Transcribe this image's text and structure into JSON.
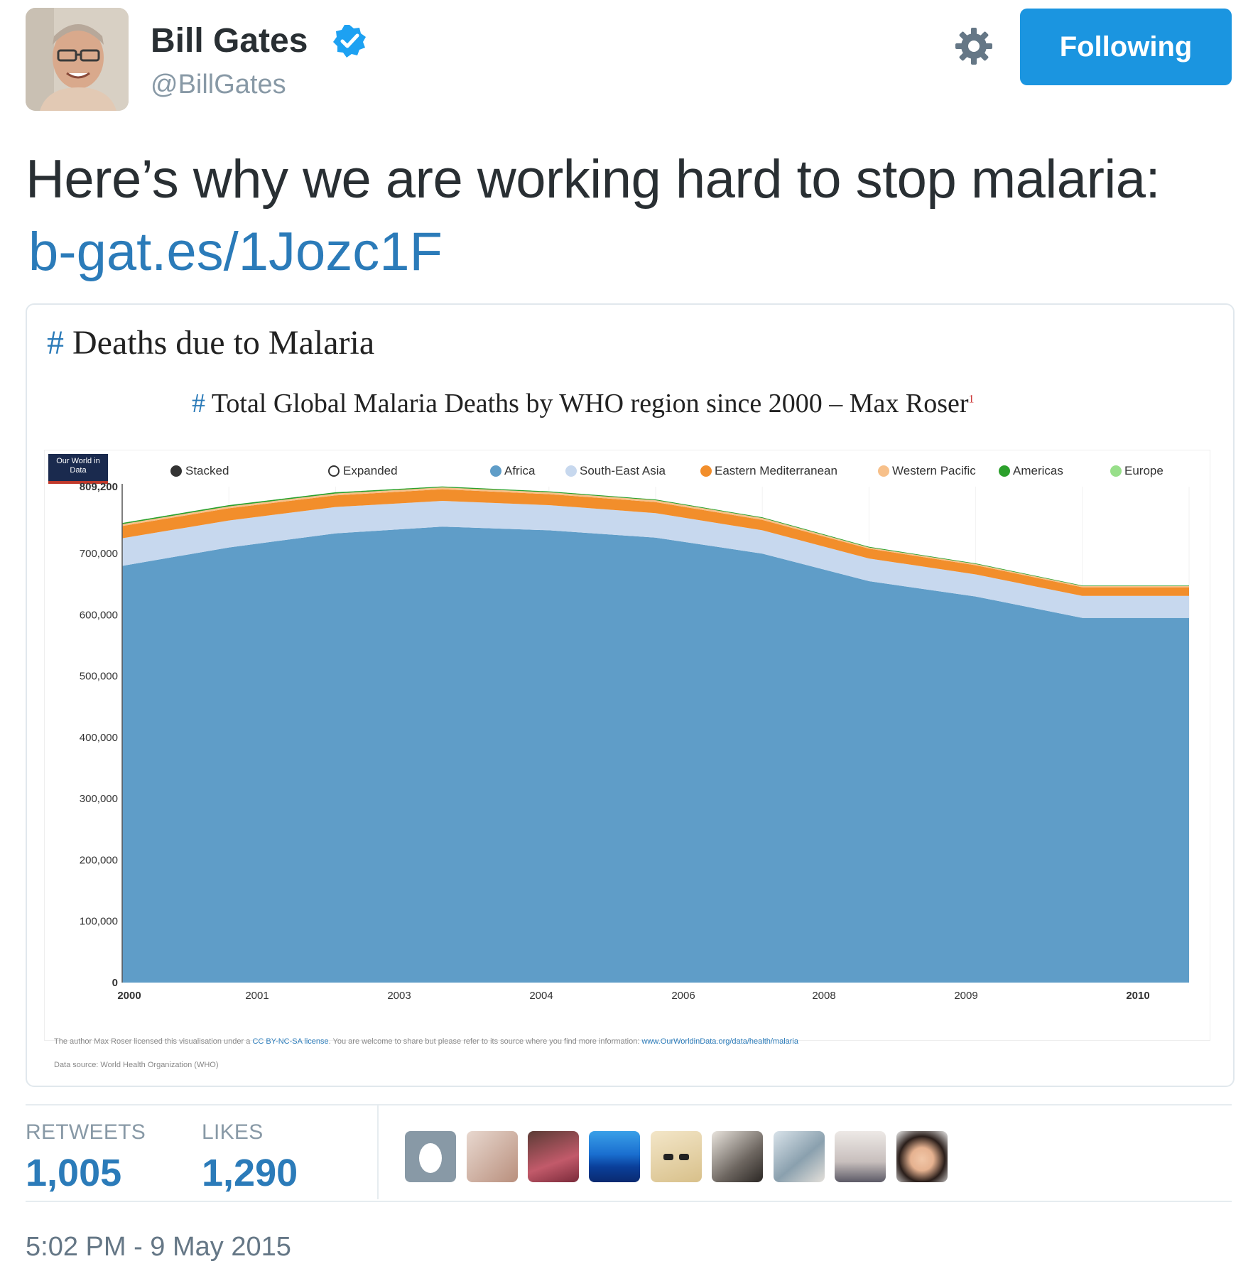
{
  "user": {
    "name": "Bill Gates",
    "handle": "@BillGates",
    "follow_label": "Following"
  },
  "tweet": {
    "text": "Here’s why we are working hard to stop malaria:",
    "link": "b-gat.es/1Jozc1F"
  },
  "card": {
    "hash": "#",
    "title": "Deaths due to Malaria",
    "chart_title": "Total Global Malaria Deaths by WHO region since 2000 – Max Roser",
    "chart_title_sup": "1",
    "logo_text": "Our World in Data",
    "controls": [
      "Stacked",
      "Expanded"
    ],
    "footnote_prefix": "The author Max Roser licensed this visualisation under a",
    "footnote_license": "CC BY-NC-SA license",
    "footnote_middle": ". You are welcome to share but please refer to its source where you find more information:",
    "footnote_url": "www.OurWorldinData.org/data/health/malaria",
    "data_source": "Data source: World Health Organization (WHO)"
  },
  "chart_data": {
    "type": "area",
    "title": "Total Global Malaria Deaths by WHO region since 2000 – Max Roser",
    "stacked": true,
    "x": [
      2000,
      2001,
      2002,
      2003,
      2004,
      2005,
      2006,
      2007,
      2008,
      2009,
      2010
    ],
    "x_tick_labels": [
      "2000",
      "2001",
      "2003",
      "2004",
      "2006",
      "2008",
      "2009",
      "2010"
    ],
    "y_tick_labels": [
      "0",
      "100,000",
      "200,000",
      "300,000",
      "400,000",
      "500,000",
      "600,000",
      "700,000",
      "809,200"
    ],
    "ylim": [
      0,
      809200
    ],
    "legend_position": "top",
    "series": [
      {
        "name": "Africa",
        "color": "#5f9dc8",
        "values": [
          680000,
          710000,
          733000,
          744000,
          738000,
          726000,
          700000,
          655000,
          630000,
          595000,
          595000
        ]
      },
      {
        "name": "South-East Asia",
        "color": "#c7d8ee",
        "values": [
          45000,
          44000,
          43000,
          42000,
          41000,
          40000,
          38000,
          37000,
          36000,
          36000,
          36000
        ]
      },
      {
        "name": "Eastern Mediterranean",
        "color": "#f28e2b",
        "values": [
          20000,
          20000,
          19000,
          19000,
          18000,
          18000,
          17000,
          16000,
          15000,
          14000,
          14000
        ]
      },
      {
        "name": "Western Pacific",
        "color": "#f7c08a",
        "values": [
          3000,
          3000,
          3000,
          3000,
          3000,
          3000,
          3000,
          2000,
          2000,
          2000,
          2000
        ]
      },
      {
        "name": "Americas",
        "color": "#2ca02c",
        "values": [
          2000,
          2000,
          2000,
          1500,
          1500,
          1300,
          1200,
          1100,
          1000,
          900,
          900
        ]
      },
      {
        "name": "Europe",
        "color": "#98df8a",
        "values": [
          100,
          100,
          100,
          100,
          100,
          100,
          50,
          50,
          50,
          0,
          0
        ]
      }
    ],
    "grid": true
  },
  "stats": {
    "retweets_label": "RETWEETS",
    "retweets_value": "1,005",
    "likes_label": "LIKES",
    "likes_value": "1,290"
  },
  "timestamp": "5:02 PM - 9 May 2015",
  "icons": {
    "verified": "verified-badge-icon",
    "gear": "gear-icon",
    "default_avatar": "egg-icon"
  },
  "colors": {
    "follow_button": "#1b95e0",
    "link": "#2b7bb9",
    "verified": "#1da1f2"
  }
}
